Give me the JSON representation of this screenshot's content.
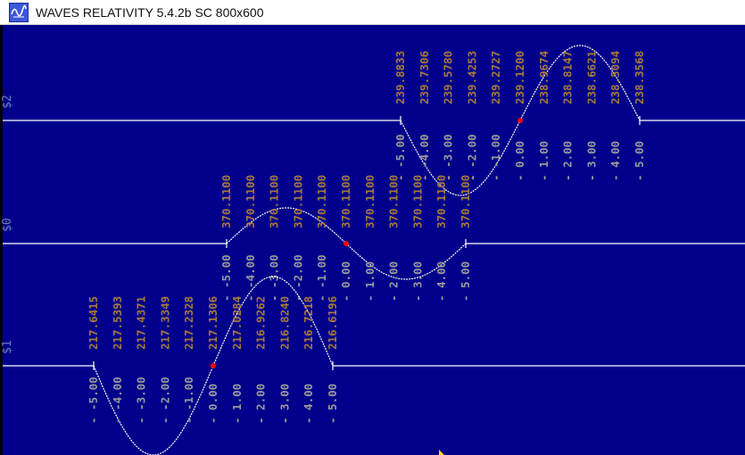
{
  "window": {
    "title": "WAVES RELATIVITY 5.4.2b SC 800x600",
    "icon": "wave-app-icon"
  },
  "colors": {
    "background": "#00008b",
    "trace": "#ffffff",
    "value_label": "#a8783d",
    "tick_label": "#9b9b9b",
    "marker": "#ff0000",
    "channel_label": "#6e7fb3"
  },
  "channels": [
    {
      "id": "s2",
      "label": "$2",
      "values": [
        "239.8833",
        "239.7306",
        "239.5780",
        "239.4253",
        "239.2727",
        "239.1200",
        "238.9674",
        "238.8147",
        "238.6621",
        "238.5094",
        "238.3568"
      ],
      "ticks": [
        "-5.00",
        "-4.00",
        "-3.00",
        "-2.00",
        "-1.00",
        "0.00",
        "1.00",
        "2.00",
        "3.00",
        "4.00",
        "5.00"
      ]
    },
    {
      "id": "s0",
      "label": "$0",
      "values": [
        "370.1100",
        "370.1100",
        "370.1100",
        "370.1100",
        "370.1100",
        "370.1100",
        "370.1100",
        "370.1100",
        "370.1100",
        "370.1100",
        "370.1100"
      ],
      "ticks": [
        "-5.00",
        "-4.00",
        "-3.00",
        "-2.00",
        "-1.00",
        "0.00",
        "1.00",
        "2.00",
        "3.00",
        "4.00",
        "5.00"
      ]
    },
    {
      "id": "s1",
      "label": "$1",
      "values": [
        "217.6415",
        "217.5393",
        "217.4371",
        "217.3349",
        "217.2328",
        "217.1306",
        "217.0284",
        "216.9262",
        "216.8240",
        "216.7218",
        "216.6196"
      ],
      "ticks": [
        "-5.00",
        "-4.00",
        "-3.00",
        "-2.00",
        "-1.00",
        "0.00",
        "1.00",
        "2.00",
        "3.00",
        "4.00",
        "5.00"
      ]
    }
  ]
}
